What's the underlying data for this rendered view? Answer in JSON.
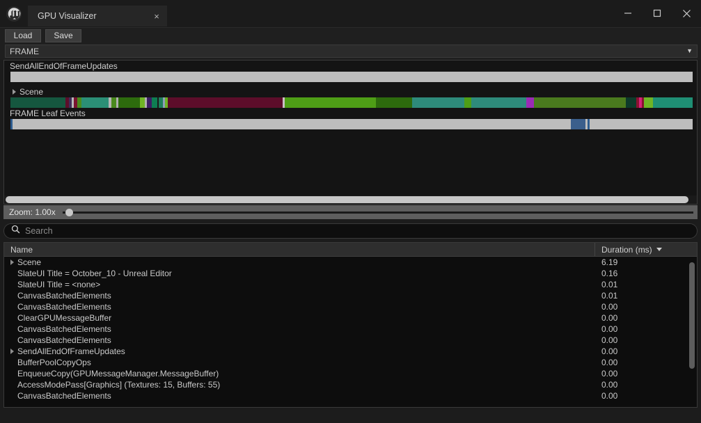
{
  "window": {
    "tab_title": "GPU Visualizer",
    "tab_close_label": "×",
    "logo_icon": "unreal-engine-logo",
    "minimize_icon": "minimize-icon",
    "maximize_icon": "maximize-icon",
    "close_icon": "close-icon"
  },
  "toolbar": {
    "load_label": "Load",
    "save_label": "Save"
  },
  "frame_selector": {
    "value": "FRAME",
    "arrow": "▼"
  },
  "timeline": {
    "tracks": [
      {
        "label": "SendAllEndOfFrameUpdates",
        "expandable": false
      },
      {
        "label": "Scene",
        "expandable": true
      },
      {
        "label": "FRAME Leaf Events",
        "expandable": false
      }
    ],
    "bars": {
      "send_all_end_of_frame_updates": [
        {
          "color": "#bdbdbd",
          "width": 100.0
        }
      ],
      "scene": [
        {
          "color": "#15573f",
          "width": 8.1
        },
        {
          "color": "#5d0d2a",
          "width": 0.5
        },
        {
          "color": "#3f2d58",
          "width": 0.4
        },
        {
          "color": "#b8b8b8",
          "width": 0.3
        },
        {
          "color": "#7a1430",
          "width": 0.5
        },
        {
          "color": "#4a8a1e",
          "width": 0.6
        },
        {
          "color": "#2b8f76",
          "width": 4.0
        },
        {
          "color": "#b6b6b6",
          "width": 0.4
        },
        {
          "color": "#4a8a1e",
          "width": 0.7
        },
        {
          "color": "#b0b0b0",
          "width": 0.3
        },
        {
          "color": "#2d6b0d",
          "width": 3.2
        },
        {
          "color": "#6fb425",
          "width": 0.7
        },
        {
          "color": "#b0b0b0",
          "width": 0.3
        },
        {
          "color": "#3b1f63",
          "width": 0.7
        },
        {
          "color": "#0e7d52",
          "width": 0.8
        },
        {
          "color": "#1a1a1a",
          "width": 0.2
        },
        {
          "color": "#1f7f5c",
          "width": 0.7
        },
        {
          "color": "#8e9fb8",
          "width": 0.3
        },
        {
          "color": "#6fb425",
          "width": 0.4
        },
        {
          "color": "#5d0d2a",
          "width": 16.8
        },
        {
          "color": "#c9c0c4",
          "width": 0.3
        },
        {
          "color": "#4e9e16",
          "width": 13.4
        },
        {
          "color": "#2d6b0d",
          "width": 5.3
        },
        {
          "color": "#2e8b7b",
          "width": 7.6
        },
        {
          "color": "#4e9e16",
          "width": 1.1
        },
        {
          "color": "#2e8b7b",
          "width": 8.0
        },
        {
          "color": "#9b2bb5",
          "width": 1.2
        },
        {
          "color": "#4a7a1e",
          "width": 13.4
        },
        {
          "color": "#0d3a2a",
          "width": 1.6
        },
        {
          "color": "#8a1230",
          "width": 0.4
        },
        {
          "color": "#d4217a",
          "width": 0.4
        },
        {
          "color": "#8a1230",
          "width": 0.3
        },
        {
          "color": "#6fb425",
          "width": 1.3
        },
        {
          "color": "#1f8f74",
          "width": 11.0
        },
        {
          "color": "#3b1f63",
          "width": 0.3
        },
        {
          "color": "#8a1230",
          "width": 0.4
        },
        {
          "color": "#bdbdbd",
          "width": 18.0
        }
      ],
      "frame_leaf_events": [
        {
          "color": "#2e5c8f",
          "width": 0.35
        },
        {
          "color": "#bdbdbd",
          "width": 81.8
        },
        {
          "color": "#3b5f8c",
          "width": 2.1
        },
        {
          "color": "#bdbdbd",
          "width": 0.3
        },
        {
          "color": "#2e5c8f",
          "width": 0.3
        },
        {
          "color": "#bdbdbd",
          "width": 15.15
        }
      ]
    },
    "hscroll_position": "full"
  },
  "zoom_control": {
    "label": "Zoom: 1.00x",
    "value": 1.0,
    "knob_position_pct": 0.5
  },
  "search": {
    "placeholder": "Search",
    "value": "",
    "icon": "search-icon"
  },
  "table": {
    "columns": [
      {
        "key": "name",
        "label": "Name"
      },
      {
        "key": "duration",
        "label": "Duration (ms)",
        "sorted": true,
        "sort_direction": "descending"
      }
    ],
    "rows": [
      {
        "name": "Scene",
        "duration": "6.19",
        "expandable": true,
        "indent": 0
      },
      {
        "name": "SlateUI Title = October_10 - Unreal Editor",
        "duration": "0.16",
        "expandable": false,
        "indent": 0
      },
      {
        "name": "SlateUI Title = <none>",
        "duration": "0.01",
        "expandable": false,
        "indent": 0
      },
      {
        "name": "CanvasBatchedElements",
        "duration": "0.01",
        "expandable": false,
        "indent": 0
      },
      {
        "name": "CanvasBatchedElements",
        "duration": "0.00",
        "expandable": false,
        "indent": 0
      },
      {
        "name": "ClearGPUMessageBuffer",
        "duration": "0.00",
        "expandable": false,
        "indent": 0
      },
      {
        "name": "CanvasBatchedElements",
        "duration": "0.00",
        "expandable": false,
        "indent": 0
      },
      {
        "name": "CanvasBatchedElements",
        "duration": "0.00",
        "expandable": false,
        "indent": 0
      },
      {
        "name": "SendAllEndOfFrameUpdates",
        "duration": "0.00",
        "expandable": true,
        "indent": 0
      },
      {
        "name": "BufferPoolCopyOps",
        "duration": "0.00",
        "expandable": false,
        "indent": 0
      },
      {
        "name": "EnqueueCopy(GPUMessageManager.MessageBuffer)",
        "duration": "0.00",
        "expandable": false,
        "indent": 0
      },
      {
        "name": "AccessModePass[Graphics] (Textures: 15, Buffers: 55)",
        "duration": "0.00",
        "expandable": false,
        "indent": 0
      },
      {
        "name": "CanvasBatchedElements",
        "duration": "0.00",
        "expandable": false,
        "indent": 0
      }
    ]
  },
  "colors": {
    "window_bg": "#1c1c1c",
    "panel_bg": "#141414",
    "text": "#cfcfcf",
    "accent_slider": "#c8c8c8"
  }
}
